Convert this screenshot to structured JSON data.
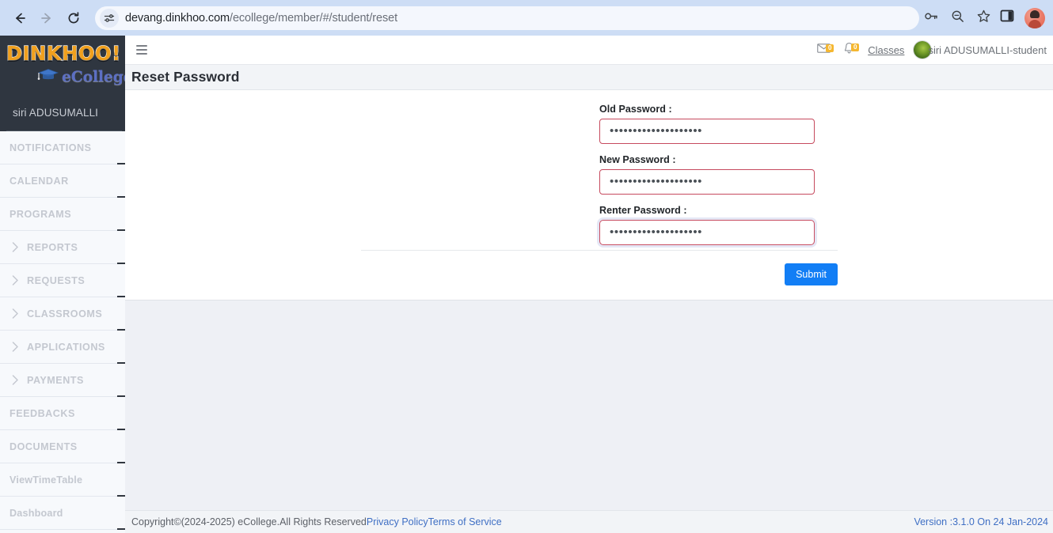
{
  "browser": {
    "back_icon": "back-arrow-icon",
    "forward_icon": "forward-arrow-icon",
    "reload_icon": "reload-icon",
    "site_info_icon": "site-settings-icon",
    "url_domain": "devang.dinkhoo.com",
    "url_path": "/ecollege/member/#/student/reset",
    "password_manager_icon": "key-icon",
    "zoom_icon": "search-zoom-icon",
    "bookmark_icon": "star-icon",
    "side_panel_icon": "side-panel-icon",
    "profile_icon": "profile-avatar-icon"
  },
  "sidebar": {
    "logo_main": "DINKHOO!",
    "logo_sub": "eCollege",
    "user": "siri ADUSUMALLI",
    "items": [
      {
        "label": "NOTIFICATIONS",
        "expandable": false
      },
      {
        "label": "CALENDAR",
        "expandable": false
      },
      {
        "label": "PROGRAMS",
        "expandable": false
      },
      {
        "label": "REPORTS",
        "expandable": true
      },
      {
        "label": "REQUESTS",
        "expandable": true
      },
      {
        "label": "CLASSROOMS",
        "expandable": true
      },
      {
        "label": "APPLICATIONS",
        "expandable": true
      },
      {
        "label": "PAYMENTS",
        "expandable": true
      },
      {
        "label": "FEEDBACKS",
        "expandable": false
      },
      {
        "label": "DOCUMENTS",
        "expandable": false
      },
      {
        "label": "ViewTimeTable",
        "expandable": false
      },
      {
        "label": "Dashboard",
        "expandable": false
      }
    ]
  },
  "topbar": {
    "menu_toggle_icon": "hamburger-icon",
    "mail_icon": "envelope-icon",
    "mail_badge": "0",
    "bell_icon": "bell-icon",
    "bell_badge": "0",
    "classes_link": "Classes",
    "avatar_icon": "user-avatar-icon",
    "user_name": "siri ADUSUMALLI-student"
  },
  "page": {
    "title": "Reset Password"
  },
  "form": {
    "fields": [
      {
        "label": "Old Password :",
        "value": "••••••••••••••••••••",
        "focused": false
      },
      {
        "label": "New Password :",
        "value": "••••••••••••••••••••",
        "focused": false
      },
      {
        "label": "Renter Password :",
        "value": "••••••••••••••••••••",
        "focused": true
      }
    ],
    "submit_label": "Submit"
  },
  "footer": {
    "copyright": "Copyright©(2024-2025) eCollege.All Rights Reserved ",
    "privacy_link": "Privacy Policy",
    "terms_link": "Terms of Service",
    "version": "Version :3.1.0 On 24 Jan-2024"
  },
  "colors": {
    "accent_blue": "#127ef5",
    "input_border": "#c64a5e",
    "sidebar_dark": "#2f3640",
    "logo_orange": "#f0a01e",
    "badge_yellow": "#f5b731"
  }
}
